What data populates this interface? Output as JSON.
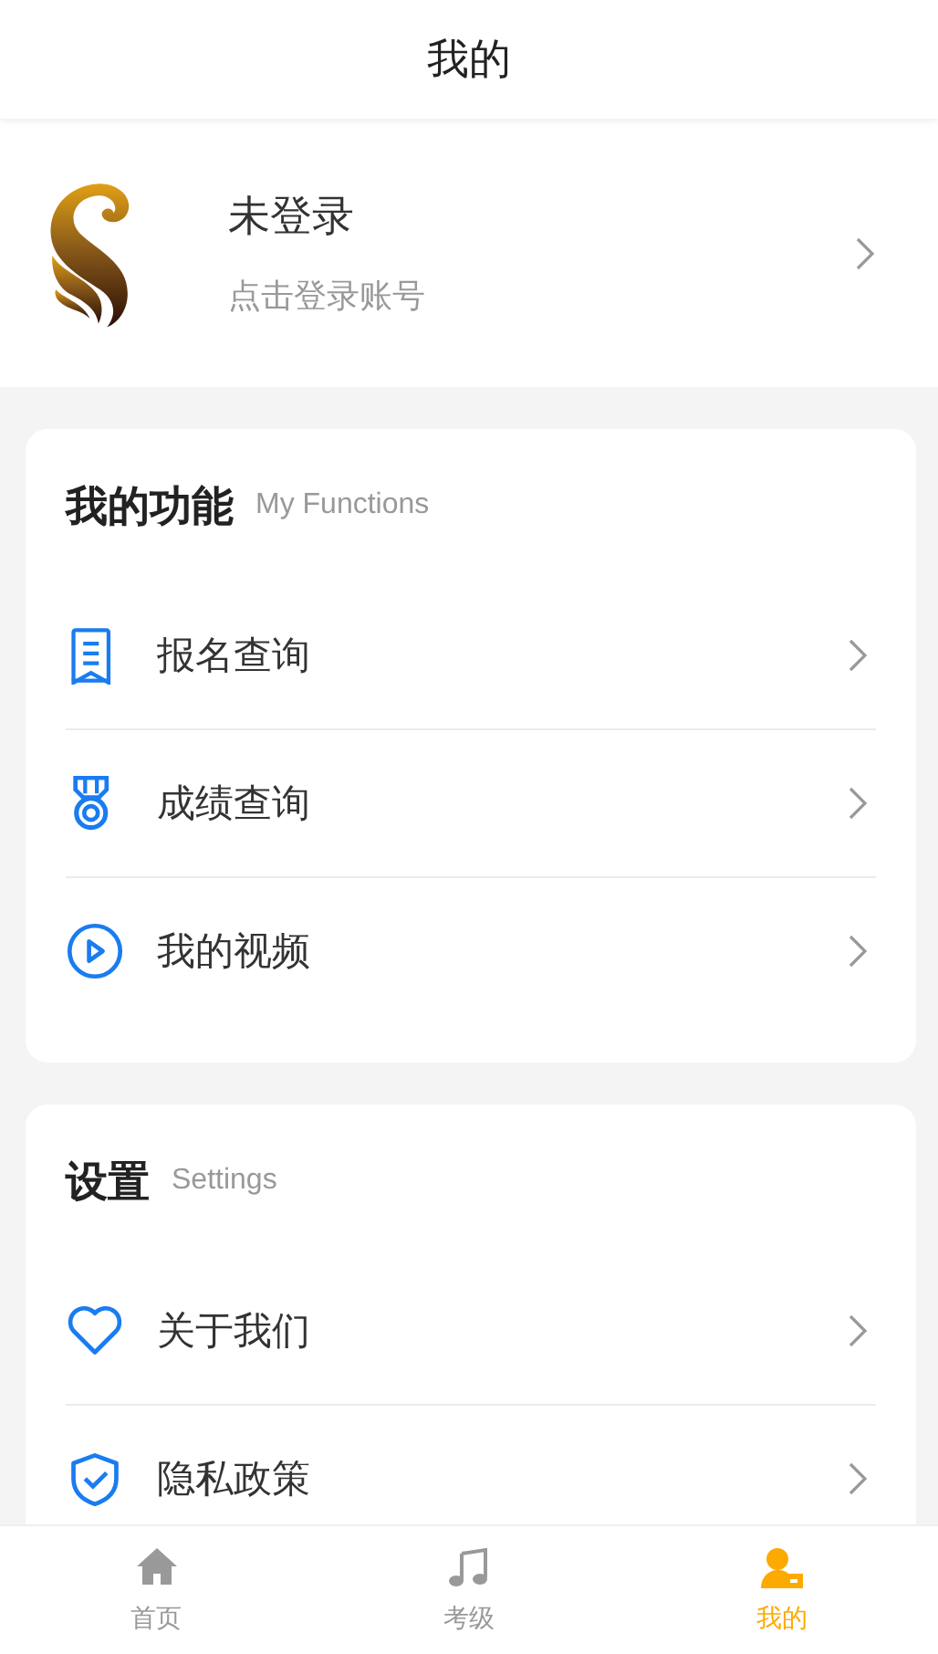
{
  "header": {
    "title": "我的"
  },
  "profile": {
    "name": "未登录",
    "hint": "点击登录账号"
  },
  "sections": [
    {
      "title": "我的功能",
      "subtitle": "My Functions",
      "items": [
        {
          "label": "报名查询"
        },
        {
          "label": "成绩查询"
        },
        {
          "label": "我的视频"
        }
      ]
    },
    {
      "title": "设置",
      "subtitle": "Settings",
      "items": [
        {
          "label": "关于我们"
        },
        {
          "label": "隐私政策"
        }
      ]
    }
  ],
  "tabs": [
    {
      "label": "首页",
      "selected": false
    },
    {
      "label": "考级",
      "selected": false
    },
    {
      "label": "我的",
      "selected": true
    }
  ]
}
